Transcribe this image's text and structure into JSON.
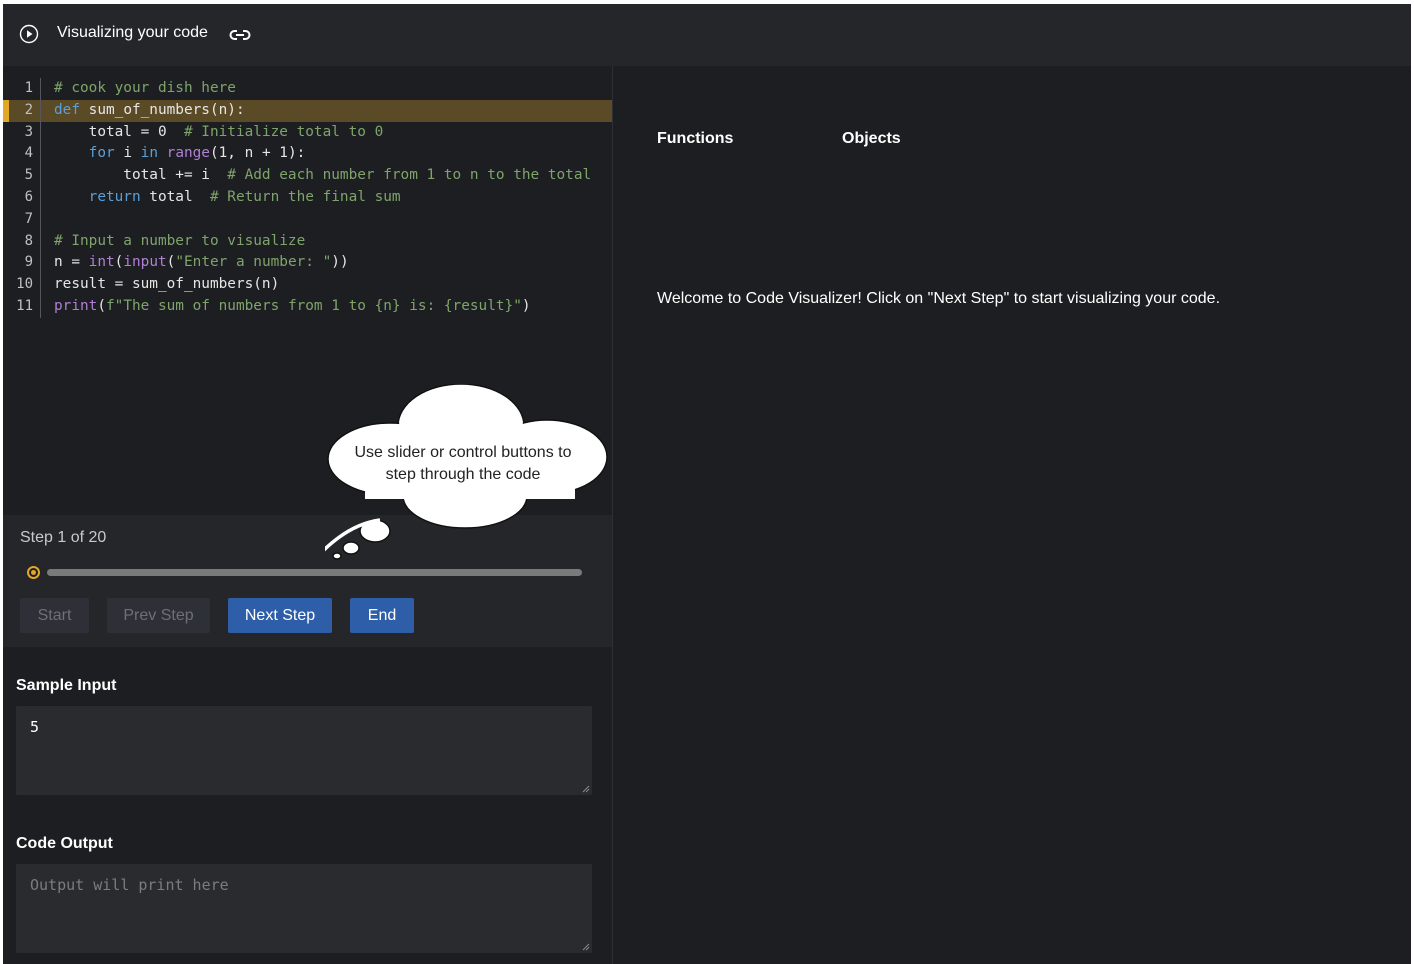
{
  "header": {
    "title": "Visualizing your code",
    "play_icon": "play-circle-icon",
    "link_icon": "link-icon"
  },
  "editor": {
    "highlighted_line": 2,
    "lines": [
      {
        "n": "1",
        "text": "# cook your dish here"
      },
      {
        "n": "2",
        "text": "def sum_of_numbers(n):"
      },
      {
        "n": "3",
        "text": "    total = 0  # Initialize total to 0"
      },
      {
        "n": "4",
        "text": "    for i in range(1, n + 1):"
      },
      {
        "n": "5",
        "text": "        total += i  # Add each number from 1 to n to the total"
      },
      {
        "n": "6",
        "text": "    return total  # Return the final sum"
      },
      {
        "n": "7",
        "text": ""
      },
      {
        "n": "8",
        "text": "# Input a number to visualize"
      },
      {
        "n": "9",
        "text": "n = int(input(\"Enter a number: \"))"
      },
      {
        "n": "10",
        "text": "result = sum_of_numbers(n)"
      },
      {
        "n": "11",
        "text": "print(f\"The sum of numbers from 1 to {n} is: {result}\")"
      }
    ]
  },
  "controls": {
    "step_label": "Step 1 of 20",
    "step_current": 1,
    "step_total": 20,
    "buttons": {
      "start": "Start",
      "prev": "Prev Step",
      "next": "Next Step",
      "end": "End"
    }
  },
  "tooltip": {
    "text": "Use  slider or control buttons to step through the code"
  },
  "sample_input": {
    "label": "Sample Input",
    "value": "5"
  },
  "code_output": {
    "label": "Code Output",
    "placeholder": "Output will print here"
  },
  "visualizer": {
    "functions_label": "Functions",
    "objects_label": "Objects",
    "welcome": "Welcome to Code Visualizer! Click on \"Next Step\" to start visualizing your code."
  },
  "colors": {
    "accent": "#e0a826",
    "button_active": "#2f5ea8",
    "background": "#1d1e21"
  }
}
